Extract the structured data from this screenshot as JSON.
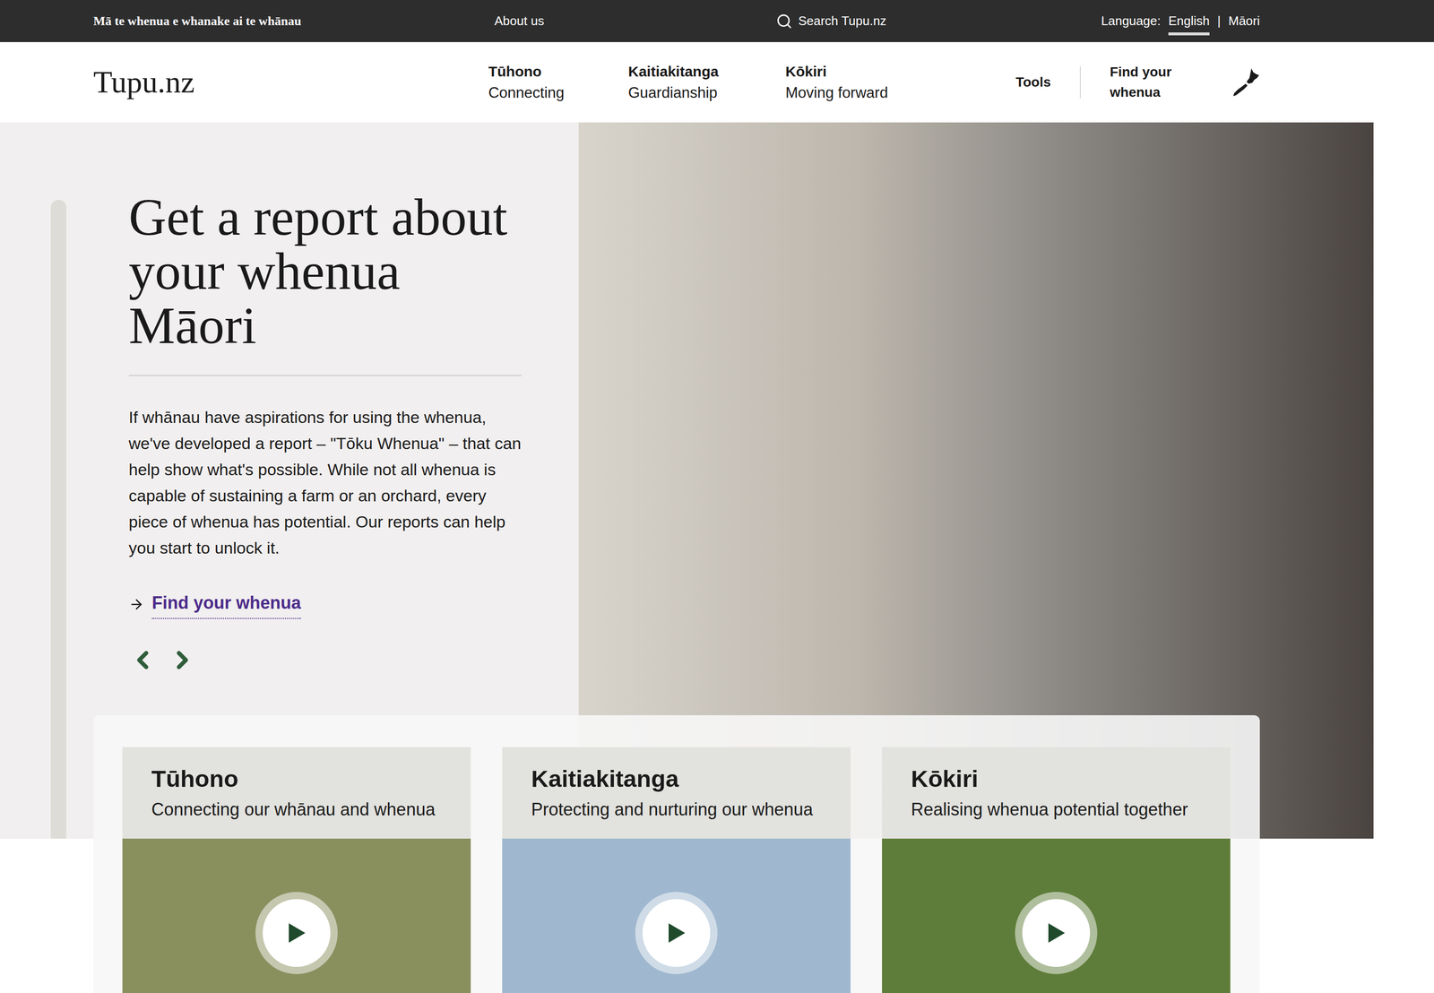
{
  "topbar": {
    "tagline": "Mā te whenua e whanake ai te whānau",
    "about": "About us",
    "search": "Search Tupu.nz",
    "language_label": "Language:",
    "languages": [
      {
        "label": "English",
        "selected": true
      },
      {
        "label": "Māori",
        "selected": false
      }
    ],
    "separator": "|"
  },
  "header": {
    "logo": "Tupu.nz",
    "nav": [
      {
        "title": "Tūhono",
        "subtitle": "Connecting"
      },
      {
        "title": "Kaitiakitanga",
        "subtitle": "Guardianship"
      },
      {
        "title": "Kōkiri",
        "subtitle": "Moving forward"
      }
    ],
    "tools": "Tools",
    "find": "Find your whenua"
  },
  "hero": {
    "heading": "Get a report about your whenua Māori",
    "body": "If whānau have aspirations for using the whenua, we've developed a report – \"Tōku Whenua\" – that can help show what's possible. While not all whenua is capable of sustaining a farm or an orchard, every piece of whenua has potential. Our reports can help you start to unlock it.",
    "link": "Find your whenua"
  },
  "cards": [
    {
      "title": "Tūhono",
      "subtitle": "Connecting our whānau and whenua",
      "color": "#8a8f5e"
    },
    {
      "title": "Kaitiakitanga",
      "subtitle": "Protecting and nurturing our whenua",
      "color": "#9fb8cf"
    },
    {
      "title": "Kōkiri",
      "subtitle": "Realising whenua potential together",
      "color": "#5f7d3a"
    }
  ]
}
